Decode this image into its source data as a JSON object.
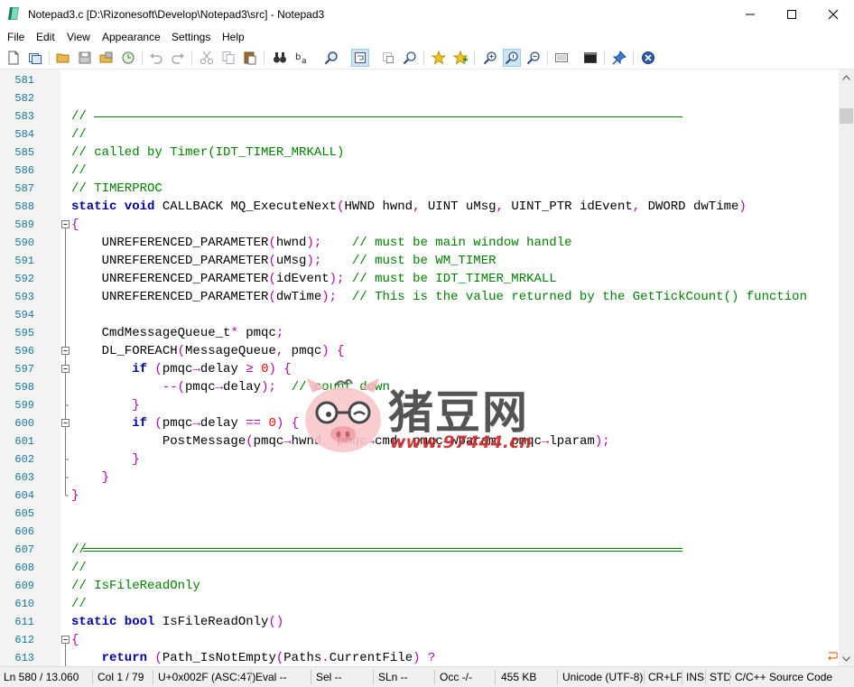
{
  "window": {
    "title": "Notepad3.c [D:\\Rizonesoft\\Develop\\Notepad3\\src] - Notepad3",
    "app_icon": "notepad3-icon",
    "controls": [
      "minimize-icon",
      "maximize-icon",
      "close-icon"
    ]
  },
  "menu": {
    "items": [
      "File",
      "Edit",
      "View",
      "Appearance",
      "Settings",
      "Help"
    ]
  },
  "toolbar": {
    "buttons": [
      {
        "name": "new-icon"
      },
      {
        "name": "new-window-icon"
      },
      {
        "name": "open-icon"
      },
      {
        "name": "save-icon"
      },
      {
        "name": "save-as-icon"
      },
      {
        "name": "browse-icon"
      },
      {
        "name": "undo-icon"
      },
      {
        "name": "redo-icon"
      },
      {
        "name": "cut-icon"
      },
      {
        "name": "copy-icon"
      },
      {
        "name": "paste-icon"
      },
      {
        "name": "find-icon"
      },
      {
        "name": "replace-icon"
      },
      {
        "name": "find-next-icon"
      },
      {
        "name": "word-wrap-icon",
        "active": true
      },
      {
        "name": "select-icon"
      },
      {
        "name": "zoom-find-icon"
      },
      {
        "name": "favorites-icon"
      },
      {
        "name": "add-favorite-icon"
      },
      {
        "name": "zoom-in-icon"
      },
      {
        "name": "zoom-reset-icon",
        "active": true
      },
      {
        "name": "zoom-out-icon"
      },
      {
        "name": "schema-icon"
      },
      {
        "name": "console-icon"
      },
      {
        "name": "pin-icon"
      },
      {
        "name": "exit-icon"
      }
    ]
  },
  "editor": {
    "lines": [
      {
        "n": "581",
        "segs": []
      },
      {
        "n": "582",
        "segs": []
      },
      {
        "n": "583",
        "segs": [
          [
            "c-cm",
            "// "
          ]
        ],
        "rule": "single"
      },
      {
        "n": "584",
        "segs": [
          [
            "c-cm",
            "//"
          ]
        ]
      },
      {
        "n": "585",
        "segs": [
          [
            "c-cm",
            "// called by Timer(IDT_TIMER_MRKALL)"
          ]
        ]
      },
      {
        "n": "586",
        "segs": [
          [
            "c-cm",
            "//"
          ]
        ]
      },
      {
        "n": "587",
        "segs": [
          [
            "c-cm",
            "// TIMERPROC"
          ]
        ]
      },
      {
        "n": "588",
        "segs": [
          [
            "c-kw",
            "static void "
          ],
          [
            "c-pl",
            "CALLBACK MQ_ExecuteNext"
          ],
          [
            "c-op",
            "("
          ],
          [
            "c-pl",
            "HWND hwnd"
          ],
          [
            "c-op",
            ", "
          ],
          [
            "c-pl",
            "UINT uMsg"
          ],
          [
            "c-op",
            ", "
          ],
          [
            "c-pl",
            "UINT_PTR idEvent"
          ],
          [
            "c-op",
            ", "
          ],
          [
            "c-pl",
            "DWORD dwTime"
          ],
          [
            "c-op",
            ")"
          ]
        ]
      },
      {
        "n": "589",
        "segs": [
          [
            "c-op",
            "{"
          ]
        ],
        "fold": "open"
      },
      {
        "n": "590",
        "segs": [
          [
            "c-pl",
            "    UNREFERENCED_PARAMETER"
          ],
          [
            "c-op",
            "("
          ],
          [
            "c-pl",
            "hwnd"
          ],
          [
            "c-op",
            ");"
          ],
          [
            "c-pl",
            "    "
          ],
          [
            "c-cm",
            "// must be main window handle"
          ]
        ],
        "fold": "line"
      },
      {
        "n": "591",
        "segs": [
          [
            "c-pl",
            "    UNREFERENCED_PARAMETER"
          ],
          [
            "c-op",
            "("
          ],
          [
            "c-pl",
            "uMsg"
          ],
          [
            "c-op",
            ");"
          ],
          [
            "c-pl",
            "    "
          ],
          [
            "c-cm",
            "// must be WM_TIMER"
          ]
        ],
        "fold": "line"
      },
      {
        "n": "592",
        "segs": [
          [
            "c-pl",
            "    UNREFERENCED_PARAMETER"
          ],
          [
            "c-op",
            "("
          ],
          [
            "c-pl",
            "idEvent"
          ],
          [
            "c-op",
            ");"
          ],
          [
            "c-pl",
            " "
          ],
          [
            "c-cm",
            "// must be IDT_TIMER_MRKALL"
          ]
        ],
        "fold": "line"
      },
      {
        "n": "593",
        "segs": [
          [
            "c-pl",
            "    UNREFERENCED_PARAMETER"
          ],
          [
            "c-op",
            "("
          ],
          [
            "c-pl",
            "dwTime"
          ],
          [
            "c-op",
            ");"
          ],
          [
            "c-pl",
            "  "
          ],
          [
            "c-cm",
            "// This is the value returned by the GetTickCount() function"
          ]
        ],
        "fold": "line"
      },
      {
        "n": "594",
        "segs": [],
        "fold": "line"
      },
      {
        "n": "595",
        "segs": [
          [
            "c-pl",
            "    CmdMessageQueue_t"
          ],
          [
            "c-op",
            "* "
          ],
          [
            "c-pl",
            "pmqc"
          ],
          [
            "c-op",
            ";"
          ]
        ],
        "fold": "line"
      },
      {
        "n": "596",
        "segs": [
          [
            "c-pl",
            "    DL_FOREACH"
          ],
          [
            "c-op",
            "("
          ],
          [
            "c-pl",
            "MessageQueue"
          ],
          [
            "c-op",
            ", "
          ],
          [
            "c-pl",
            "pmqc"
          ],
          [
            "c-op",
            ") {"
          ]
        ],
        "fold": "open"
      },
      {
        "n": "597",
        "segs": [
          [
            "c-kw",
            "        if "
          ],
          [
            "c-op",
            "("
          ],
          [
            "c-pl",
            "pmqc"
          ],
          [
            "c-op",
            "→"
          ],
          [
            "c-pl",
            "delay "
          ],
          [
            "c-op",
            "≥ "
          ],
          [
            "c-num",
            "0"
          ],
          [
            "c-op",
            ") {"
          ]
        ],
        "fold": "open"
      },
      {
        "n": "598",
        "segs": [
          [
            "c-op",
            "            --("
          ],
          [
            "c-pl",
            "pmqc"
          ],
          [
            "c-op",
            "→"
          ],
          [
            "c-pl",
            "delay"
          ],
          [
            "c-op",
            ");"
          ],
          [
            "c-pl",
            "  "
          ],
          [
            "c-cm",
            "// count down"
          ]
        ],
        "fold": "line"
      },
      {
        "n": "599",
        "segs": [
          [
            "c-op",
            "        }"
          ]
        ],
        "fold": "end"
      },
      {
        "n": "600",
        "segs": [
          [
            "c-kw",
            "        if "
          ],
          [
            "c-op",
            "("
          ],
          [
            "c-pl",
            "pmqc"
          ],
          [
            "c-op",
            "→"
          ],
          [
            "c-pl",
            "delay "
          ],
          [
            "c-op",
            "== "
          ],
          [
            "c-num",
            "0"
          ],
          [
            "c-op",
            ") {"
          ]
        ],
        "fold": "open"
      },
      {
        "n": "601",
        "segs": [
          [
            "c-pl",
            "            PostMessage"
          ],
          [
            "c-op",
            "("
          ],
          [
            "c-pl",
            "pmqc"
          ],
          [
            "c-op",
            "→"
          ],
          [
            "c-pl",
            "hwnd"
          ],
          [
            "c-op",
            ", "
          ],
          [
            "c-pl",
            "pmqc"
          ],
          [
            "c-op",
            "→"
          ],
          [
            "c-pl",
            "cmd"
          ],
          [
            "c-op",
            ", "
          ],
          [
            "c-pl",
            "pmqc"
          ],
          [
            "c-op",
            "→"
          ],
          [
            "c-pl",
            "wparam"
          ],
          [
            "c-op",
            ", "
          ],
          [
            "c-pl",
            "pmqc"
          ],
          [
            "c-op",
            "→"
          ],
          [
            "c-pl",
            "lparam"
          ],
          [
            "c-op",
            ");"
          ]
        ],
        "fold": "line"
      },
      {
        "n": "602",
        "segs": [
          [
            "c-op",
            "        }"
          ]
        ],
        "fold": "end"
      },
      {
        "n": "603",
        "segs": [
          [
            "c-op",
            "    }"
          ]
        ],
        "fold": "end"
      },
      {
        "n": "604",
        "segs": [
          [
            "c-op",
            "}"
          ]
        ],
        "fold": "close"
      },
      {
        "n": "605",
        "segs": []
      },
      {
        "n": "606",
        "segs": []
      },
      {
        "n": "607",
        "segs": [
          [
            "c-cm",
            "//"
          ]
        ],
        "rule": "double"
      },
      {
        "n": "608",
        "segs": [
          [
            "c-cm",
            "//"
          ]
        ]
      },
      {
        "n": "609",
        "segs": [
          [
            "c-cm",
            "// IsFileReadOnly"
          ]
        ]
      },
      {
        "n": "610",
        "segs": [
          [
            "c-cm",
            "//"
          ]
        ]
      },
      {
        "n": "611",
        "segs": [
          [
            "c-kw",
            "static bool "
          ],
          [
            "c-pl",
            "IsFileReadOnly"
          ],
          [
            "c-op",
            "()"
          ]
        ]
      },
      {
        "n": "612",
        "segs": [
          [
            "c-op",
            "{"
          ]
        ],
        "fold": "open"
      },
      {
        "n": "613",
        "segs": [
          [
            "c-kw",
            "    return "
          ],
          [
            "c-op",
            "("
          ],
          [
            "c-pl",
            "Path_IsNotEmpty"
          ],
          [
            "c-op",
            "("
          ],
          [
            "c-pl",
            "Paths"
          ],
          [
            "c-op",
            "."
          ],
          [
            "c-pl",
            "CurrentFile"
          ],
          [
            "c-op",
            ") ?"
          ]
        ],
        "fold": "line"
      }
    ]
  },
  "watermark": {
    "big": "猪豆网",
    "small": "www.97444.cn"
  },
  "status": {
    "ln": "Ln  580 / 13.060",
    "col": "Col  1 / 79",
    "unicode": "U+0x002F (ASC:47)",
    "eval": "Eval  --",
    "sel": "Sel  --",
    "sln": "SLn  --",
    "occ": "Occ  -/-",
    "size": "455 KB",
    "encoding": "Unicode (UTF-8)",
    "eol": "CR+LF",
    "ins": "INS",
    "std": "STD",
    "lexer": "C/C++ Source Code"
  }
}
